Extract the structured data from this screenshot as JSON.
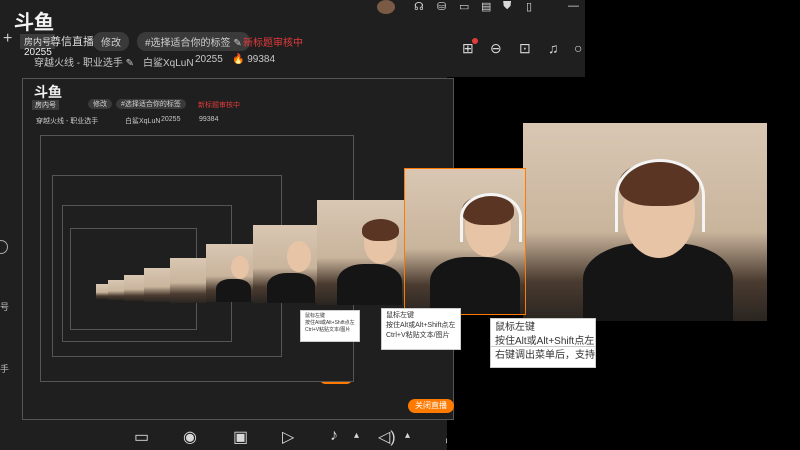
{
  "header": {
    "logo": "斗鱼",
    "room_badge": "房内号",
    "room_id": "20255",
    "title": "尊信直播了~",
    "edit_button": "修改",
    "tag_label": "#选择适合你的标签",
    "notice": "新标题审核中",
    "category": "穿越火线 - 职业选手",
    "streamer": "白鲨XqLuN",
    "room_id_text": "20255",
    "heat": "99384",
    "red_dot_count": "1"
  },
  "toolbar": {
    "go_live_button": "关闭直播"
  },
  "tooltip": {
    "lines": [
      "鼠标左键",
      "按住Alt或Alt+Shift点左",
      "Ctrl+V粘贴文本/图片",
      "右键调出菜单后，支持"
    ]
  },
  "left_edge": {
    "label_a": "号",
    "label_b": "手"
  },
  "icons": {
    "top": [
      "avatar",
      "headset-icon",
      "bag-icon",
      "screen-icon",
      "document-icon",
      "shirt-icon",
      "minimize-icon"
    ],
    "header_right": [
      "gift-icon",
      "lock-icon",
      "box-icon",
      "cube-icon",
      "bell-icon",
      "circle-icon"
    ],
    "bottom": [
      "message-icon",
      "camera-icon",
      "image-icon",
      "play-icon",
      "mic-icon",
      "volume-icon"
    ]
  },
  "colors": {
    "accent": "#ff7a00",
    "notice": "#e23b3b"
  }
}
